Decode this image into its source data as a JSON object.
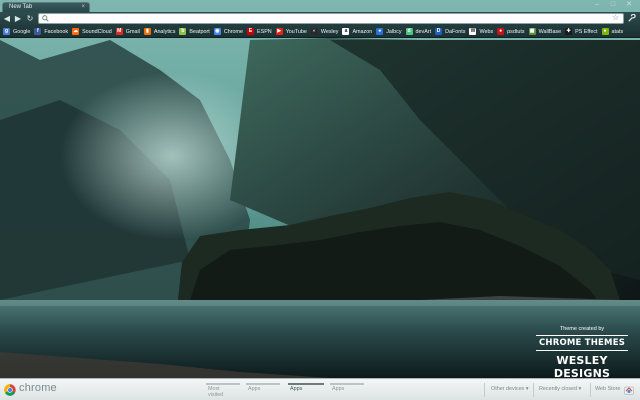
{
  "window": {
    "tab_title": "New Tab",
    "tab_close": "×",
    "controls": {
      "minimize": "–",
      "maximize": "□",
      "close": "✕"
    }
  },
  "toolbar": {
    "back": "◀",
    "forward": "▶",
    "reload": "↻",
    "omnibox_value": "",
    "star": "☆",
    "wrench": "🔧"
  },
  "bookmarks": [
    {
      "label": "Google",
      "icon": "google-icon",
      "color": "#4a7bd6",
      "glyph": "g"
    },
    {
      "label": "Facebook",
      "icon": "facebook-icon",
      "color": "#3b5998",
      "glyph": "f"
    },
    {
      "label": "SoundCloud",
      "icon": "soundcloud-icon",
      "color": "#ff6a00",
      "glyph": "☁"
    },
    {
      "label": "Gmail",
      "icon": "gmail-icon",
      "color": "#d93025",
      "glyph": "M"
    },
    {
      "label": "Analytics",
      "icon": "analytics-icon",
      "color": "#e8710a",
      "glyph": "▮"
    },
    {
      "label": "Beatport",
      "icon": "beatport-icon",
      "color": "#8bc34a",
      "glyph": "b"
    },
    {
      "label": "Chrome",
      "icon": "chrome-icon",
      "color": "#4285f4",
      "glyph": "◉"
    },
    {
      "label": "ESPN",
      "icon": "espn-icon",
      "color": "#cc0000",
      "glyph": "E"
    },
    {
      "label": "YouTube",
      "icon": "youtube-icon",
      "color": "#e62117",
      "glyph": "▶"
    },
    {
      "label": "Wesley",
      "icon": "wesley-icon",
      "color": "#2a2a2a",
      "glyph": "◐"
    },
    {
      "label": "Amazon",
      "icon": "amazon-icon",
      "color": "#ffffff",
      "glyph": "a"
    },
    {
      "label": "Jalbcy",
      "icon": "jalbcy-icon",
      "color": "#2b6fd6",
      "glyph": "●"
    },
    {
      "label": "devArt",
      "icon": "deviantart-icon",
      "color": "#4dc47d",
      "glyph": "d"
    },
    {
      "label": "DaFonts",
      "icon": "dafont-icon",
      "color": "#1f5fbf",
      "glyph": "D"
    },
    {
      "label": "Webs",
      "icon": "webs-icon",
      "color": "#ffffff",
      "glyph": "W"
    },
    {
      "label": "psdtuts",
      "icon": "psdtuts-icon",
      "color": "#c4121b",
      "glyph": "●"
    },
    {
      "label": "WallBase",
      "icon": "wallbase-icon",
      "color": "#5b8f3c",
      "glyph": "▦"
    },
    {
      "label": "PS Effect",
      "icon": "pseffect-icon",
      "color": "#1a1a1a",
      "glyph": "✚"
    },
    {
      "label": "atats",
      "icon": "atats-icon",
      "color": "#7cb800",
      "glyph": "●"
    }
  ],
  "credit": {
    "caption": "Theme created by",
    "line1": "CHROME THEMES",
    "line2": "WESLEY DESIGNS"
  },
  "footer": {
    "brand": "chrome",
    "tabs": [
      {
        "label": "Most visited",
        "active": false
      },
      {
        "label": "Apps",
        "active": false
      },
      {
        "label": "Apps",
        "active": true
      },
      {
        "label": "Apps",
        "active": false
      }
    ],
    "other_devices": "Other devices ▾",
    "recently_closed": "Recently closed ▾",
    "web_store": "Web Store"
  },
  "colors": {
    "toolbar": "#2e4c4f",
    "bookmarks_bar": "#1f3638",
    "water": "#2a4a4c",
    "foliage": "#1c2a20"
  }
}
